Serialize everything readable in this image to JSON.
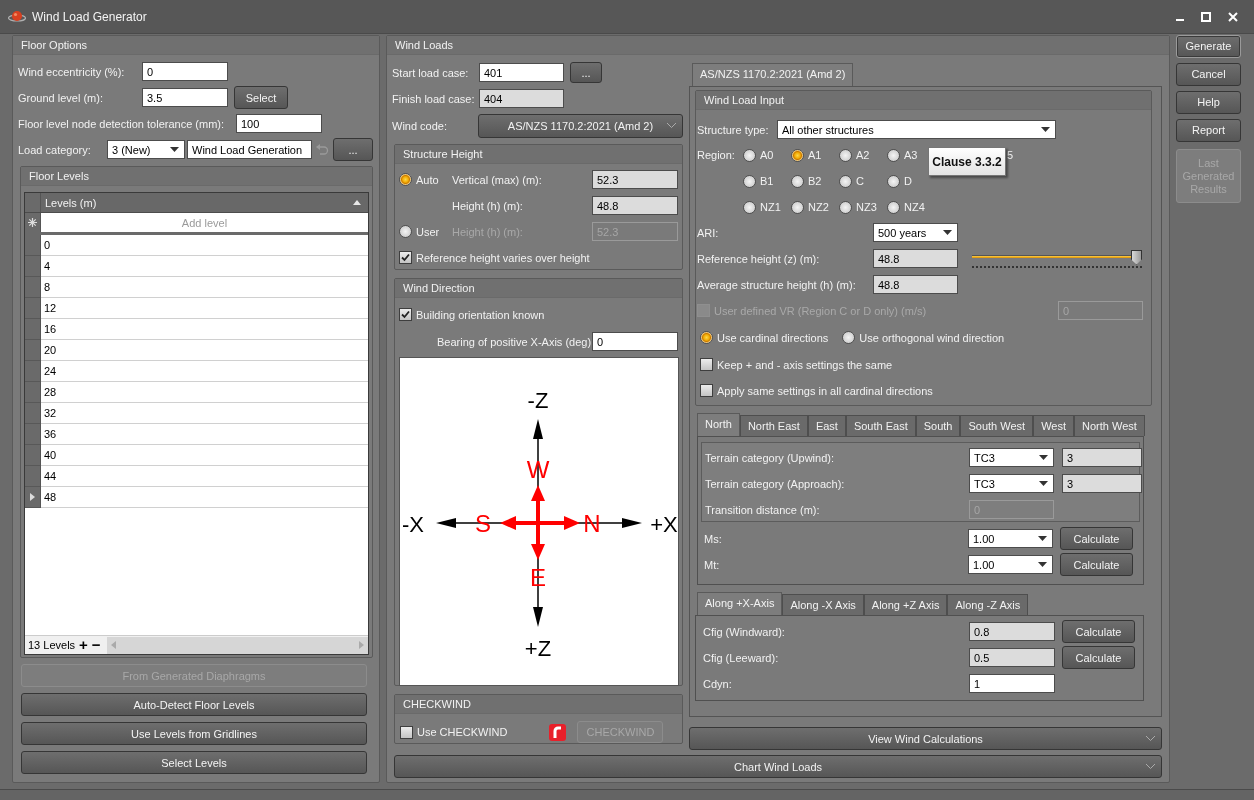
{
  "window": {
    "title": "Wind Load Generator"
  },
  "floor_options": {
    "title": "Floor Options",
    "eccentricity": {
      "label": "Wind eccentricity (%):",
      "value": "0"
    },
    "ground_level": {
      "label": "Ground level (m):",
      "value": "3.5",
      "button": "Select"
    },
    "tolerance": {
      "label": "Floor level node detection tolerance (mm):",
      "value": "100"
    },
    "load_category": {
      "label": "Load category:",
      "value": "3 (New)",
      "name": "Wind Load Generation",
      "button": "..."
    },
    "floor_levels": {
      "title": "Floor Levels",
      "column": "Levels (m)",
      "placeholder": "Add level",
      "count": "13 Levels",
      "add": "+",
      "remove": "−",
      "rows": [
        {
          "value": "0",
          "selected": false
        },
        {
          "value": "4",
          "selected": false
        },
        {
          "value": "8",
          "selected": false
        },
        {
          "value": "12",
          "selected": false
        },
        {
          "value": "16",
          "selected": false
        },
        {
          "value": "20",
          "selected": false
        },
        {
          "value": "24",
          "selected": false
        },
        {
          "value": "28",
          "selected": false
        },
        {
          "value": "32",
          "selected": false
        },
        {
          "value": "36",
          "selected": false
        },
        {
          "value": "40",
          "selected": false
        },
        {
          "value": "44",
          "selected": false
        },
        {
          "value": "48",
          "selected": true
        }
      ]
    },
    "buttons": [
      {
        "label": "From Generated Diaphragms",
        "disabled": true
      },
      {
        "label": "Auto-Detect Floor Levels",
        "disabled": false
      },
      {
        "label": "Use Levels from Gridlines",
        "disabled": false
      },
      {
        "label": "Select Levels",
        "disabled": false
      }
    ]
  },
  "wind_loads": {
    "title": "Wind Loads",
    "start_load_case": {
      "label": "Start load case:",
      "value": "401",
      "button": "..."
    },
    "finish_load_case": {
      "label": "Finish load case:",
      "value": "404"
    },
    "wind_code": {
      "label": "Wind code:",
      "value": "AS/NZS 1170.2:2021 (Amd 2)"
    },
    "structure_height": {
      "title": "Structure Height",
      "options": [
        {
          "label": "Auto",
          "selected": true
        },
        {
          "label": "User",
          "selected": false
        }
      ],
      "vertical": {
        "label": "Vertical (max) (m):",
        "value": "52.3"
      },
      "height": {
        "label": "Height (h) (m):",
        "value": "48.8"
      },
      "user_height": {
        "label": "Height (h) (m):",
        "value": "52.3"
      },
      "varies": {
        "label": "Reference height varies over height",
        "checked": true
      }
    },
    "wind_direction": {
      "title": "Wind Direction",
      "orientation": {
        "label": "Building orientation known",
        "checked": true
      },
      "bearing": {
        "label": "Bearing of positive X-Axis (deg):",
        "value": "0"
      },
      "axis_labels": [
        "-Z",
        "+Z",
        "-X",
        "+X"
      ],
      "direction_labels": [
        "W",
        "E",
        "S",
        "N"
      ]
    },
    "checkwind": {
      "title": "CHECKWIND",
      "use": {
        "label": "Use CHECKWIND",
        "checked": false
      },
      "button": {
        "label": "CHECKWIND",
        "disabled": true
      }
    },
    "code_tab": {
      "label": "AS/NZS 1170.2:2021 (Amd 2)",
      "selected": true
    },
    "wind_load_input": {
      "title": "Wind Load Input",
      "structure_type": {
        "label": "Structure type:",
        "value": "All other structures"
      },
      "region": {
        "label": "Region:",
        "tooltip": "Clause 3.3.2",
        "rows": [
          {
            "options": [
              {
                "kind": "radio",
                "label": "A0",
                "selected": false
              },
              {
                "kind": "radio",
                "label": "A1",
                "selected": true
              },
              {
                "kind": "radio",
                "label": "A2",
                "selected": false
              },
              {
                "kind": "radio",
                "label": "A3",
                "selected": false
              },
              {
                "kind": "cut",
                "label": "5"
              }
            ]
          },
          {
            "options": [
              {
                "kind": "radio",
                "label": "B1",
                "selected": false
              },
              {
                "kind": "radio",
                "label": "B2",
                "selected": false
              },
              {
                "kind": "radio",
                "label": "C",
                "selected": false
              },
              {
                "kind": "radio",
                "label": "D",
                "selected": false
              }
            ]
          },
          {
            "options": [
              {
                "kind": "radio",
                "label": "NZ1",
                "selected": false
              },
              {
                "kind": "radio",
                "label": "NZ2",
                "selected": false
              },
              {
                "kind": "radio",
                "label": "NZ3",
                "selected": false
              },
              {
                "kind": "radio",
                "label": "NZ4",
                "selected": false
              }
            ]
          }
        ]
      },
      "ari": {
        "label": "ARI:",
        "value": "500 years"
      },
      "reference_height": {
        "label": "Reference height (z) (m):",
        "value": "48.8",
        "level": 1
      },
      "average_height": {
        "label": "Average structure height (h) (m):",
        "value": "48.8"
      },
      "user_vr": {
        "label": "User defined VR (Region C or D only) (m/s)",
        "checked": false,
        "disabled": true,
        "value": "0"
      },
      "direction_mode": [
        {
          "label": "Use cardinal directions",
          "selected": true
        },
        {
          "label": "Use orthogonal wind direction",
          "selected": false
        }
      ],
      "options": [
        {
          "label": "Keep + and - axis settings the same",
          "checked": false
        },
        {
          "label": "Apply same settings in all cardinal directions",
          "checked": false
        }
      ]
    },
    "direction_tabs": [
      {
        "label": "North",
        "selected": true
      },
      {
        "label": "North East",
        "selected": false
      },
      {
        "label": "East",
        "selected": false
      },
      {
        "label": "South East",
        "selected": false
      },
      {
        "label": "South",
        "selected": false
      },
      {
        "label": "South West",
        "selected": false
      },
      {
        "label": "West",
        "selected": false
      },
      {
        "label": "North West",
        "selected": false
      }
    ],
    "terrain": {
      "upwind": {
        "label": "Terrain category (Upwind):",
        "value": "TC3",
        "reading": "3"
      },
      "approach": {
        "label": "Terrain category (Approach):",
        "value": "TC3",
        "reading": "3"
      },
      "transition": {
        "label": "Transition distance (m):",
        "value": "0"
      }
    },
    "multipliers": [
      {
        "label": "Ms:",
        "value": "1.00",
        "button": "Calculate"
      },
      {
        "label": "Mt:",
        "value": "1.00",
        "button": "Calculate"
      }
    ],
    "axis_tabs": [
      {
        "label": "Along +X-Axis",
        "selected": true
      },
      {
        "label": "Along -X Axis",
        "selected": false
      },
      {
        "label": "Along +Z Axis",
        "selected": false
      },
      {
        "label": "Along -Z Axis",
        "selected": false
      }
    ],
    "coefficients": [
      {
        "kind": "calc",
        "label": "Cfig (Windward):",
        "value": "0.8",
        "button": "Calculate"
      },
      {
        "kind": "calc",
        "label": "Cfig (Leeward):",
        "value": "0.5",
        "button": "Calculate"
      },
      {
        "kind": "plain",
        "label": "Cdyn:",
        "value": "1"
      }
    ],
    "view_calculations": "View Wind Calculations",
    "chart_button": "Chart Wind Loads"
  },
  "side_buttons": [
    {
      "label": "Generate",
      "disabled": false,
      "focused": true
    },
    {
      "label": "Cancel",
      "disabled": false,
      "focused": false
    },
    {
      "label": "Help",
      "disabled": false,
      "focused": false
    },
    {
      "label": "Report",
      "disabled": false,
      "focused": false
    },
    {
      "label": "Last Generated Results",
      "disabled": true,
      "focused": false
    }
  ]
}
